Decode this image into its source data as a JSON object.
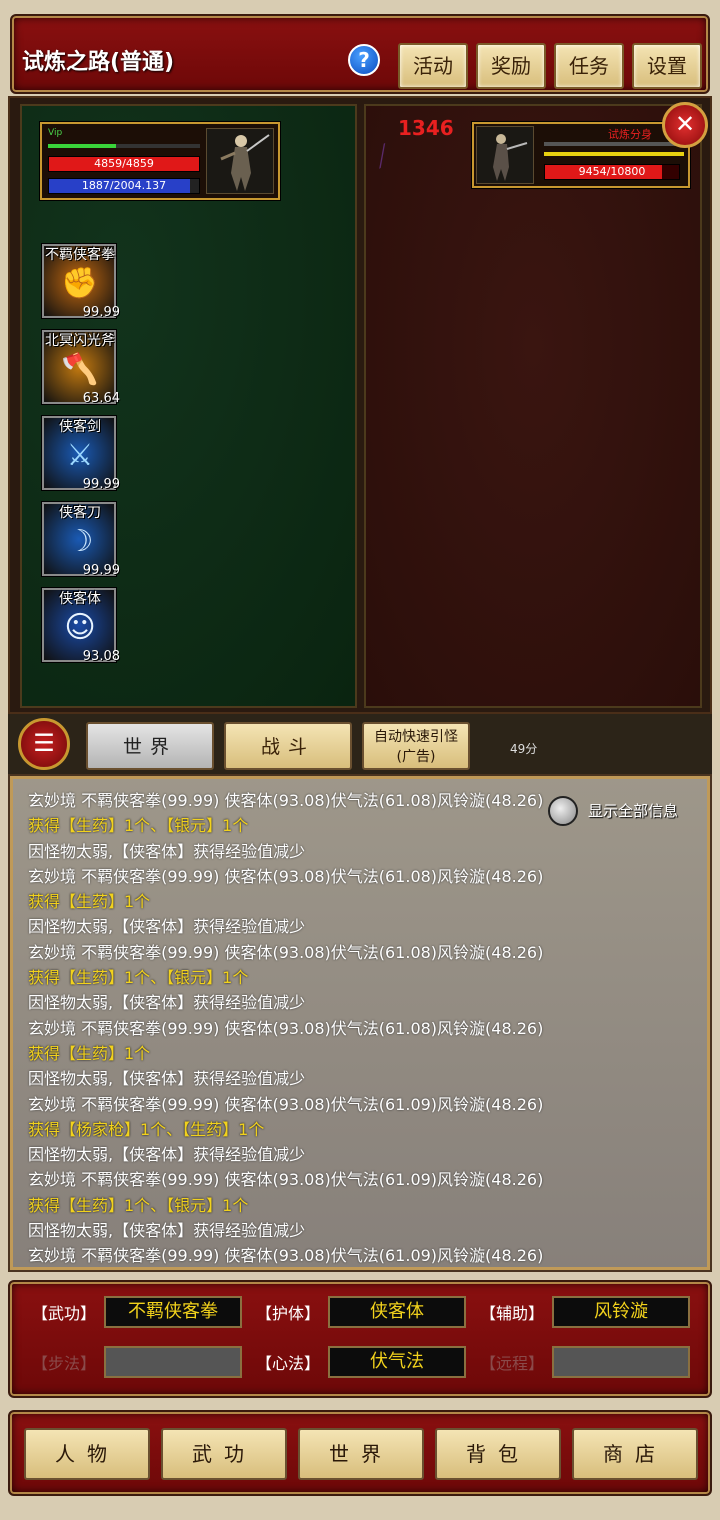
{
  "header": {
    "title": "试炼之路(普通)",
    "help": "?",
    "buttons": [
      "活动",
      "奖励",
      "任务",
      "设置"
    ]
  },
  "player": {
    "vip": "Vip",
    "hp_text": "4859/4859",
    "hp_fraction": 1.0,
    "mp_text": "1887/2004.137",
    "mp_fraction": 0.94,
    "exp_fraction": 0.45
  },
  "enemy": {
    "name": "试炼分身",
    "hp_text": "9454/10800",
    "hp_fraction": 0.875
  },
  "damage_number": "1346",
  "skills": [
    {
      "name": "不羁侠客拳",
      "value": "99.99",
      "icon": "fist-icon",
      "color": "#c46a10"
    },
    {
      "name": "北冥闪光斧",
      "value": "63.64",
      "icon": "axe-icon",
      "color": "#c47a10"
    },
    {
      "name": "侠客剑",
      "value": "99.99",
      "icon": "sword-icon",
      "color": "#1a5ab4"
    },
    {
      "name": "侠客刀",
      "value": "99.99",
      "icon": "blade-icon",
      "color": "#1a5ab4"
    },
    {
      "name": "侠客体",
      "value": "93.08",
      "icon": "body-icon",
      "color": "#1a4aa4"
    }
  ],
  "tabs": {
    "world": "世界",
    "battle": "战斗",
    "auto_line1": "自动快速引怪",
    "auto_line2": "(广告)",
    "timer": "49分"
  },
  "log": {
    "show_all_label": "显示全部信息",
    "lines": [
      {
        "type": "info",
        "text": "玄妙境 不羁侠客拳(99.99) 侠客体(93.08)伏气法(61.08)风铃漩(48.26)"
      },
      {
        "type": "gain",
        "text": "获得【生药】1个、【银元】1个"
      },
      {
        "type": "info",
        "text": "因怪物太弱,【侠客体】获得经验值减少"
      },
      {
        "type": "info",
        "text": "玄妙境 不羁侠客拳(99.99) 侠客体(93.08)伏气法(61.08)风铃漩(48.26)"
      },
      {
        "type": "gain",
        "text": "获得【生药】1个"
      },
      {
        "type": "info",
        "text": "因怪物太弱,【侠客体】获得经验值减少"
      },
      {
        "type": "info",
        "text": "玄妙境 不羁侠客拳(99.99) 侠客体(93.08)伏气法(61.08)风铃漩(48.26)"
      },
      {
        "type": "gain",
        "text": "获得【生药】1个、【银元】1个"
      },
      {
        "type": "info",
        "text": "因怪物太弱,【侠客体】获得经验值减少"
      },
      {
        "type": "info",
        "text": "玄妙境 不羁侠客拳(99.99) 侠客体(93.08)伏气法(61.08)风铃漩(48.26)"
      },
      {
        "type": "gain",
        "text": "获得【生药】1个"
      },
      {
        "type": "info",
        "text": "因怪物太弱,【侠客体】获得经验值减少"
      },
      {
        "type": "info",
        "text": "玄妙境 不羁侠客拳(99.99) 侠客体(93.08)伏气法(61.09)风铃漩(48.26)"
      },
      {
        "type": "gain",
        "text": "获得【杨家枪】1个、【生药】1个"
      },
      {
        "type": "info",
        "text": "因怪物太弱,【侠客体】获得经验值减少"
      },
      {
        "type": "info",
        "text": "玄妙境 不羁侠客拳(99.99) 侠客体(93.08)伏气法(61.09)风铃漩(48.26)"
      },
      {
        "type": "gain",
        "text": "获得【生药】1个、【银元】1个"
      },
      {
        "type": "info",
        "text": "因怪物太弱,【侠客体】获得经验值减少"
      },
      {
        "type": "info",
        "text": "玄妙境 不羁侠客拳(99.99) 侠客体(93.08)伏气法(61.09)风铃漩(48.26)"
      }
    ]
  },
  "equipment": {
    "wugong_label": "【武功】",
    "wugong": "不羁侠客拳",
    "huti_label": "【护体】",
    "huti": "侠客体",
    "fuzhu_label": "【辅助】",
    "fuzhu": "风铃漩",
    "bufa_label": "【步法】",
    "bufa": "",
    "xinfa_label": "【心法】",
    "xinfa": "伏气法",
    "yuancheng_label": "【远程】",
    "yuancheng": ""
  },
  "nav": [
    "人物",
    "武功",
    "世界",
    "背包",
    "商店"
  ]
}
